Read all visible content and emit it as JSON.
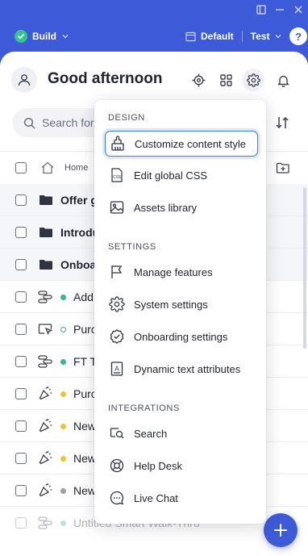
{
  "topbar": {
    "build_label": "Build",
    "environment_label": "Default",
    "mode_label": "Test",
    "help_label": "?"
  },
  "header": {
    "greeting": "Good afternoon"
  },
  "search": {
    "placeholder": "Search for"
  },
  "breadcrumb": {
    "home_label": "Home"
  },
  "rows": [
    {
      "type": "folder",
      "label": "Offer g"
    },
    {
      "type": "folder",
      "label": "Introdu"
    },
    {
      "type": "folder",
      "label": "Onboa"
    },
    {
      "type": "item",
      "icon": "smart-walkthru-icon",
      "status_color": "#35b59a",
      "label": "Add"
    },
    {
      "type": "item",
      "icon": "launcher-icon",
      "status_color": "outline",
      "label": "Purc"
    },
    {
      "type": "item",
      "icon": "smart-walkthru-icon",
      "status_color": "#35b59a",
      "label": "FT T"
    },
    {
      "type": "item",
      "icon": "shoutout-icon",
      "status_color": "#f1c232",
      "label": "Purc"
    },
    {
      "type": "item",
      "icon": "shoutout-icon",
      "status_color": "#f1c232",
      "label": "New"
    },
    {
      "type": "item",
      "icon": "shoutout-icon",
      "status_color": "#f1c232",
      "label": "New"
    },
    {
      "type": "item",
      "icon": "shoutout-icon",
      "status_color": "#9a9ea8",
      "label": "New"
    },
    {
      "type": "item",
      "icon": "smart-walkthru-icon",
      "status_color": "#35b59a",
      "label": "Untitled Smart Walk-Thru"
    }
  ],
  "menu": {
    "sections": {
      "design": "DESIGN",
      "settings": "SETTINGS",
      "integrations": "INTEGRATIONS"
    },
    "items": {
      "customize": "Customize content style",
      "css": "Edit global CSS",
      "assets": "Assets library",
      "features": "Manage features",
      "system": "System settings",
      "onboarding": "Onboarding settings",
      "dynamic": "Dynamic text attributes",
      "search": "Search",
      "helpdesk": "Help Desk",
      "livechat": "Live Chat"
    }
  },
  "colors": {
    "accent": "#3d5bd9",
    "success": "#35c38f",
    "warning": "#f1c232",
    "focus_ring": "#3d7be8"
  }
}
